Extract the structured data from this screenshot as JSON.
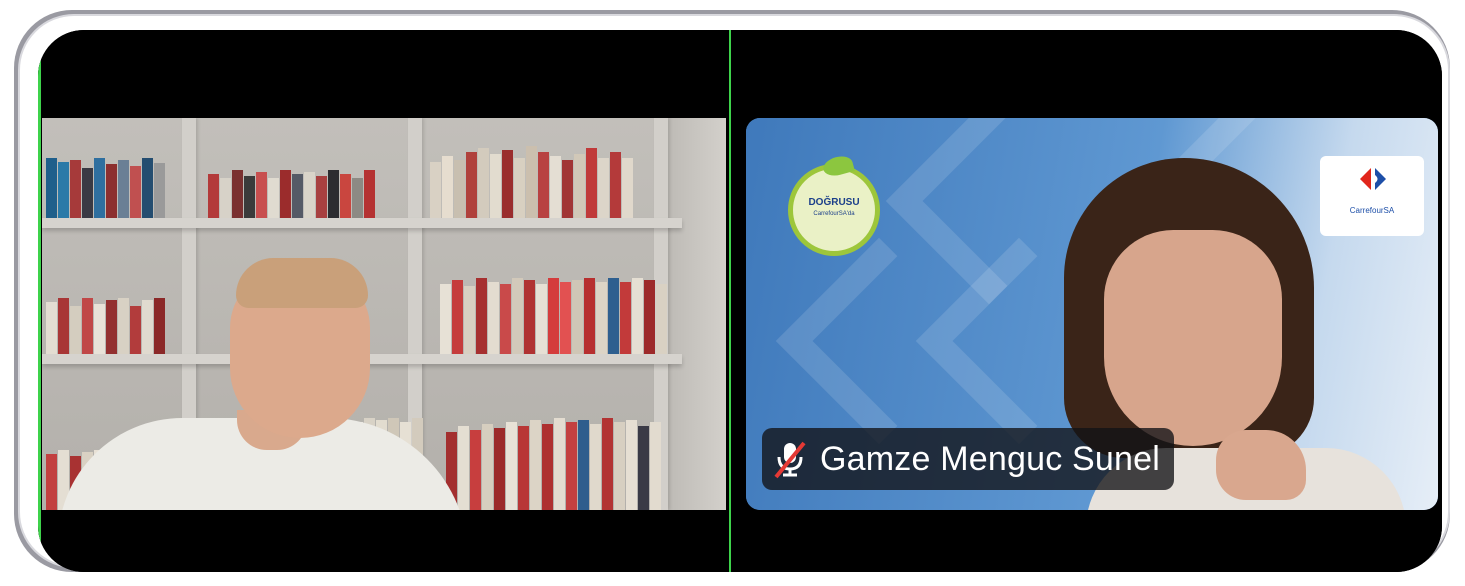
{
  "call": {
    "participants": [
      {
        "tile": "left",
        "name": "",
        "muted": false,
        "background": "bookshelf"
      },
      {
        "tile": "right",
        "name": "Gamze Menguc Sunel",
        "muted": true,
        "background": "branded-backdrop",
        "badge": {
          "title": "DOĞRUSU",
          "subtitle": "CarrefourSA'da"
        },
        "brand": {
          "text": "CarrefourSA"
        }
      }
    ]
  },
  "colors": {
    "active_speaker_border": "#3ed34b",
    "name_tag_bg": "#121216",
    "muted_icon_slash": "#e53935",
    "brand_blue": "#1d4fa8",
    "badge_green": "#9dc63b"
  },
  "icons": {
    "mic_muted": "microphone-off-icon"
  }
}
